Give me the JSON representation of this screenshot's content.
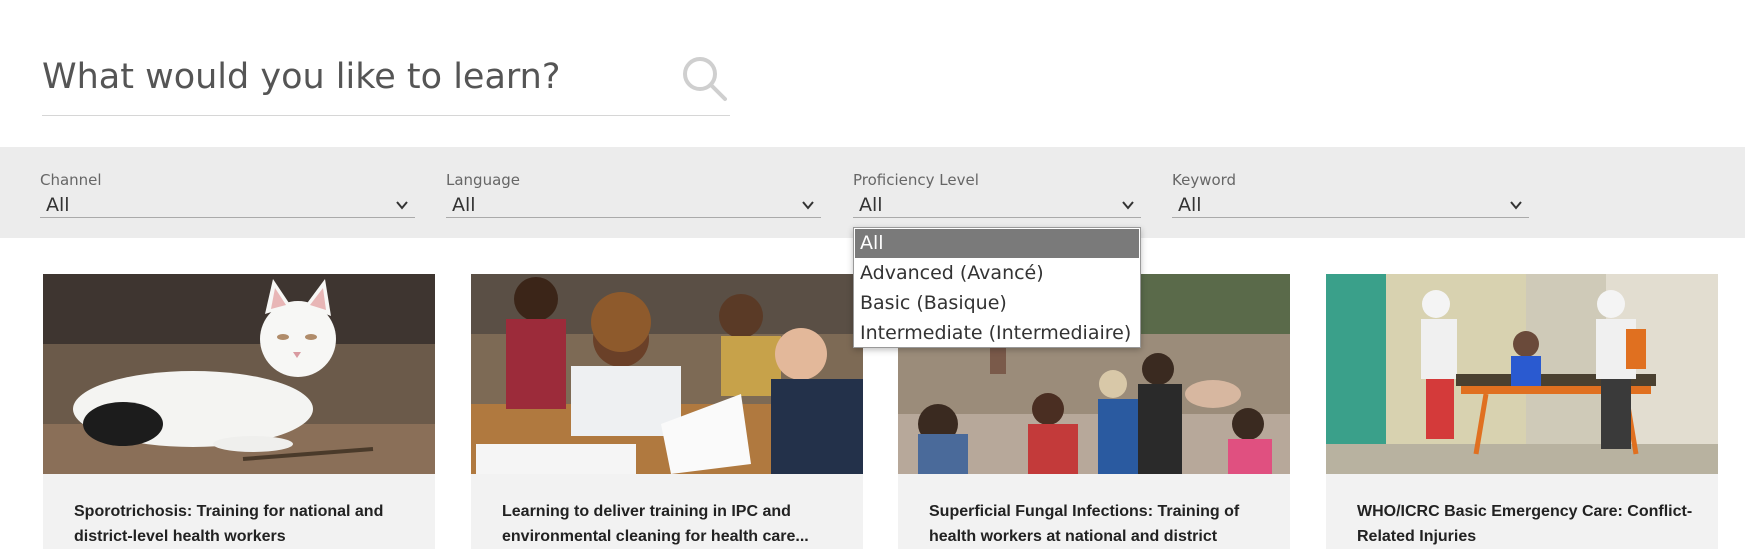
{
  "search": {
    "placeholder": "What would you like to learn?",
    "icon": "search-icon"
  },
  "filters": [
    {
      "label": "Channel",
      "value": "All"
    },
    {
      "label": "Language",
      "value": "All"
    },
    {
      "label": "Proficiency Level",
      "value": "All"
    },
    {
      "label": "Keyword",
      "value": "All"
    }
  ],
  "proficiency_dropdown": {
    "options": [
      "All",
      "Advanced (Avancé)",
      "Basic (Basique)",
      "Intermediate (Intermediaire)"
    ],
    "selected": "All"
  },
  "courses": [
    {
      "title": "Sporotrichosis: Training for national and district-level health workers",
      "image": "white-cat-photo"
    },
    {
      "title": "Learning to deliver training in IPC and environmental cleaning for health care...",
      "image": "health-workers-reading-photo"
    },
    {
      "title": "Superficial Fungal Infections: Training of health workers at national and district level...",
      "image": "village-crowd-photo"
    },
    {
      "title": "WHO/ICRC Basic Emergency Care: Conflict-Related Injuries",
      "image": "stretcher-emergency-photo"
    }
  ],
  "colors": {
    "filter_bar": "#ececec",
    "selected_option": "#7a7a7a",
    "card_bg": "#f2f2f2"
  }
}
